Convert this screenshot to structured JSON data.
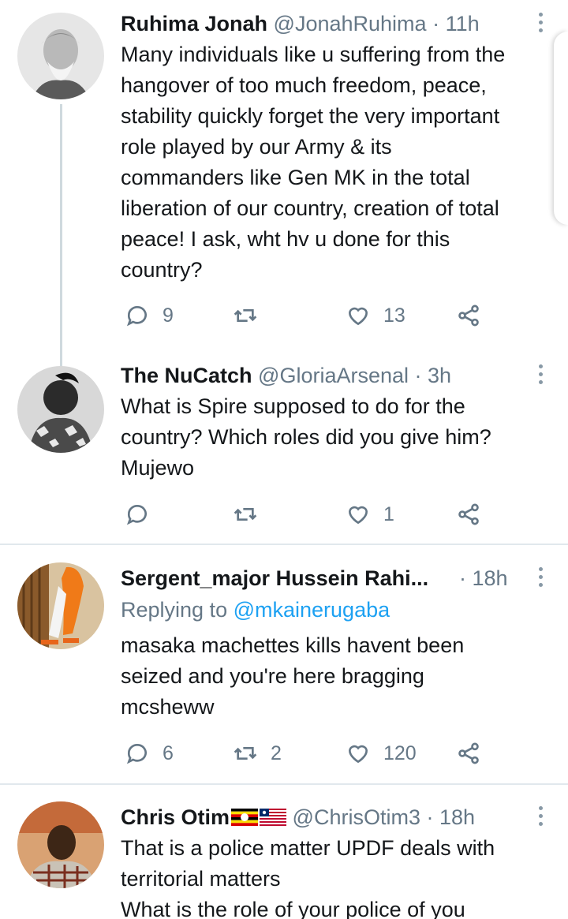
{
  "tweets": [
    {
      "name": "Ruhima Jonah",
      "handle": "@JonahRuhima",
      "time": "· 11h",
      "text": "Many individuals like u suffering from the\nhangover of too much freedom, peace,\nstability quickly forget the very important\nrole played by our Army & its\ncommanders like Gen MK in the total\nliberation of our country, creation of total\npeace! I ask, wht hv u done for this\ncountry?",
      "replies": "9",
      "retweets": "",
      "likes": "13"
    },
    {
      "name": "The NuCatch",
      "handle": "@GloriaArsenal",
      "time": "· 3h",
      "text": "What is Spire supposed to do for the\ncountry? Which roles did you give him?\nMujewo",
      "replies": "",
      "retweets": "",
      "likes": "1"
    },
    {
      "name": "Sergent_major Hussein Rahi...",
      "handle": "",
      "time": "· 18h",
      "replying_prefix": "Replying to ",
      "replying_to": "@mkainerugaba",
      "text": "masaka machettes kills havent been\nseized and you're here bragging\nmcsheww",
      "replies": "6",
      "retweets": "2",
      "likes": "120"
    },
    {
      "name": "Chris Otim",
      "handle": "@ChrisOtim3",
      "time": "· 18h",
      "text": "That is a police matter UPDF deals with\nterritorial matters\nWhat is the role of your police of you",
      "flags": [
        "uganda-flag",
        "liberia-flag"
      ]
    }
  ],
  "colors": {
    "text": "#14171a",
    "secondary": "#657786",
    "link": "#1da1f2",
    "divider": "#e1e8ed",
    "thread_line": "#cfd9de"
  },
  "icons": [
    "reply-icon",
    "retweet-icon",
    "like-icon",
    "share-icon",
    "more-icon"
  ]
}
